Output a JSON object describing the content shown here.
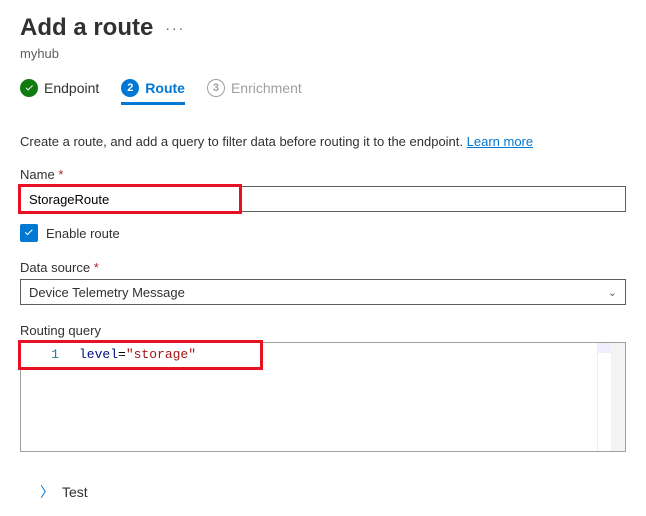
{
  "header": {
    "title": "Add a route",
    "breadcrumb": "myhub"
  },
  "stepper": {
    "step1": {
      "num": "✓",
      "label": "Endpoint"
    },
    "step2": {
      "num": "2",
      "label": "Route"
    },
    "step3": {
      "num": "3",
      "label": "Enrichment"
    }
  },
  "description": {
    "text": "Create a route, and add a query to filter data before routing it to the endpoint. ",
    "learn_more": "Learn more"
  },
  "form": {
    "name_label": "Name",
    "name_value": "StorageRoute",
    "enable_checked": true,
    "enable_label": "Enable route",
    "data_source_label": "Data source",
    "data_source_value": "Device Telemetry Message",
    "routing_query_label": "Routing query",
    "routing_query_line_num": "1",
    "routing_query_ident": "level",
    "routing_query_op": "=",
    "routing_query_str": "\"storage\""
  },
  "test": {
    "label": "Test"
  }
}
